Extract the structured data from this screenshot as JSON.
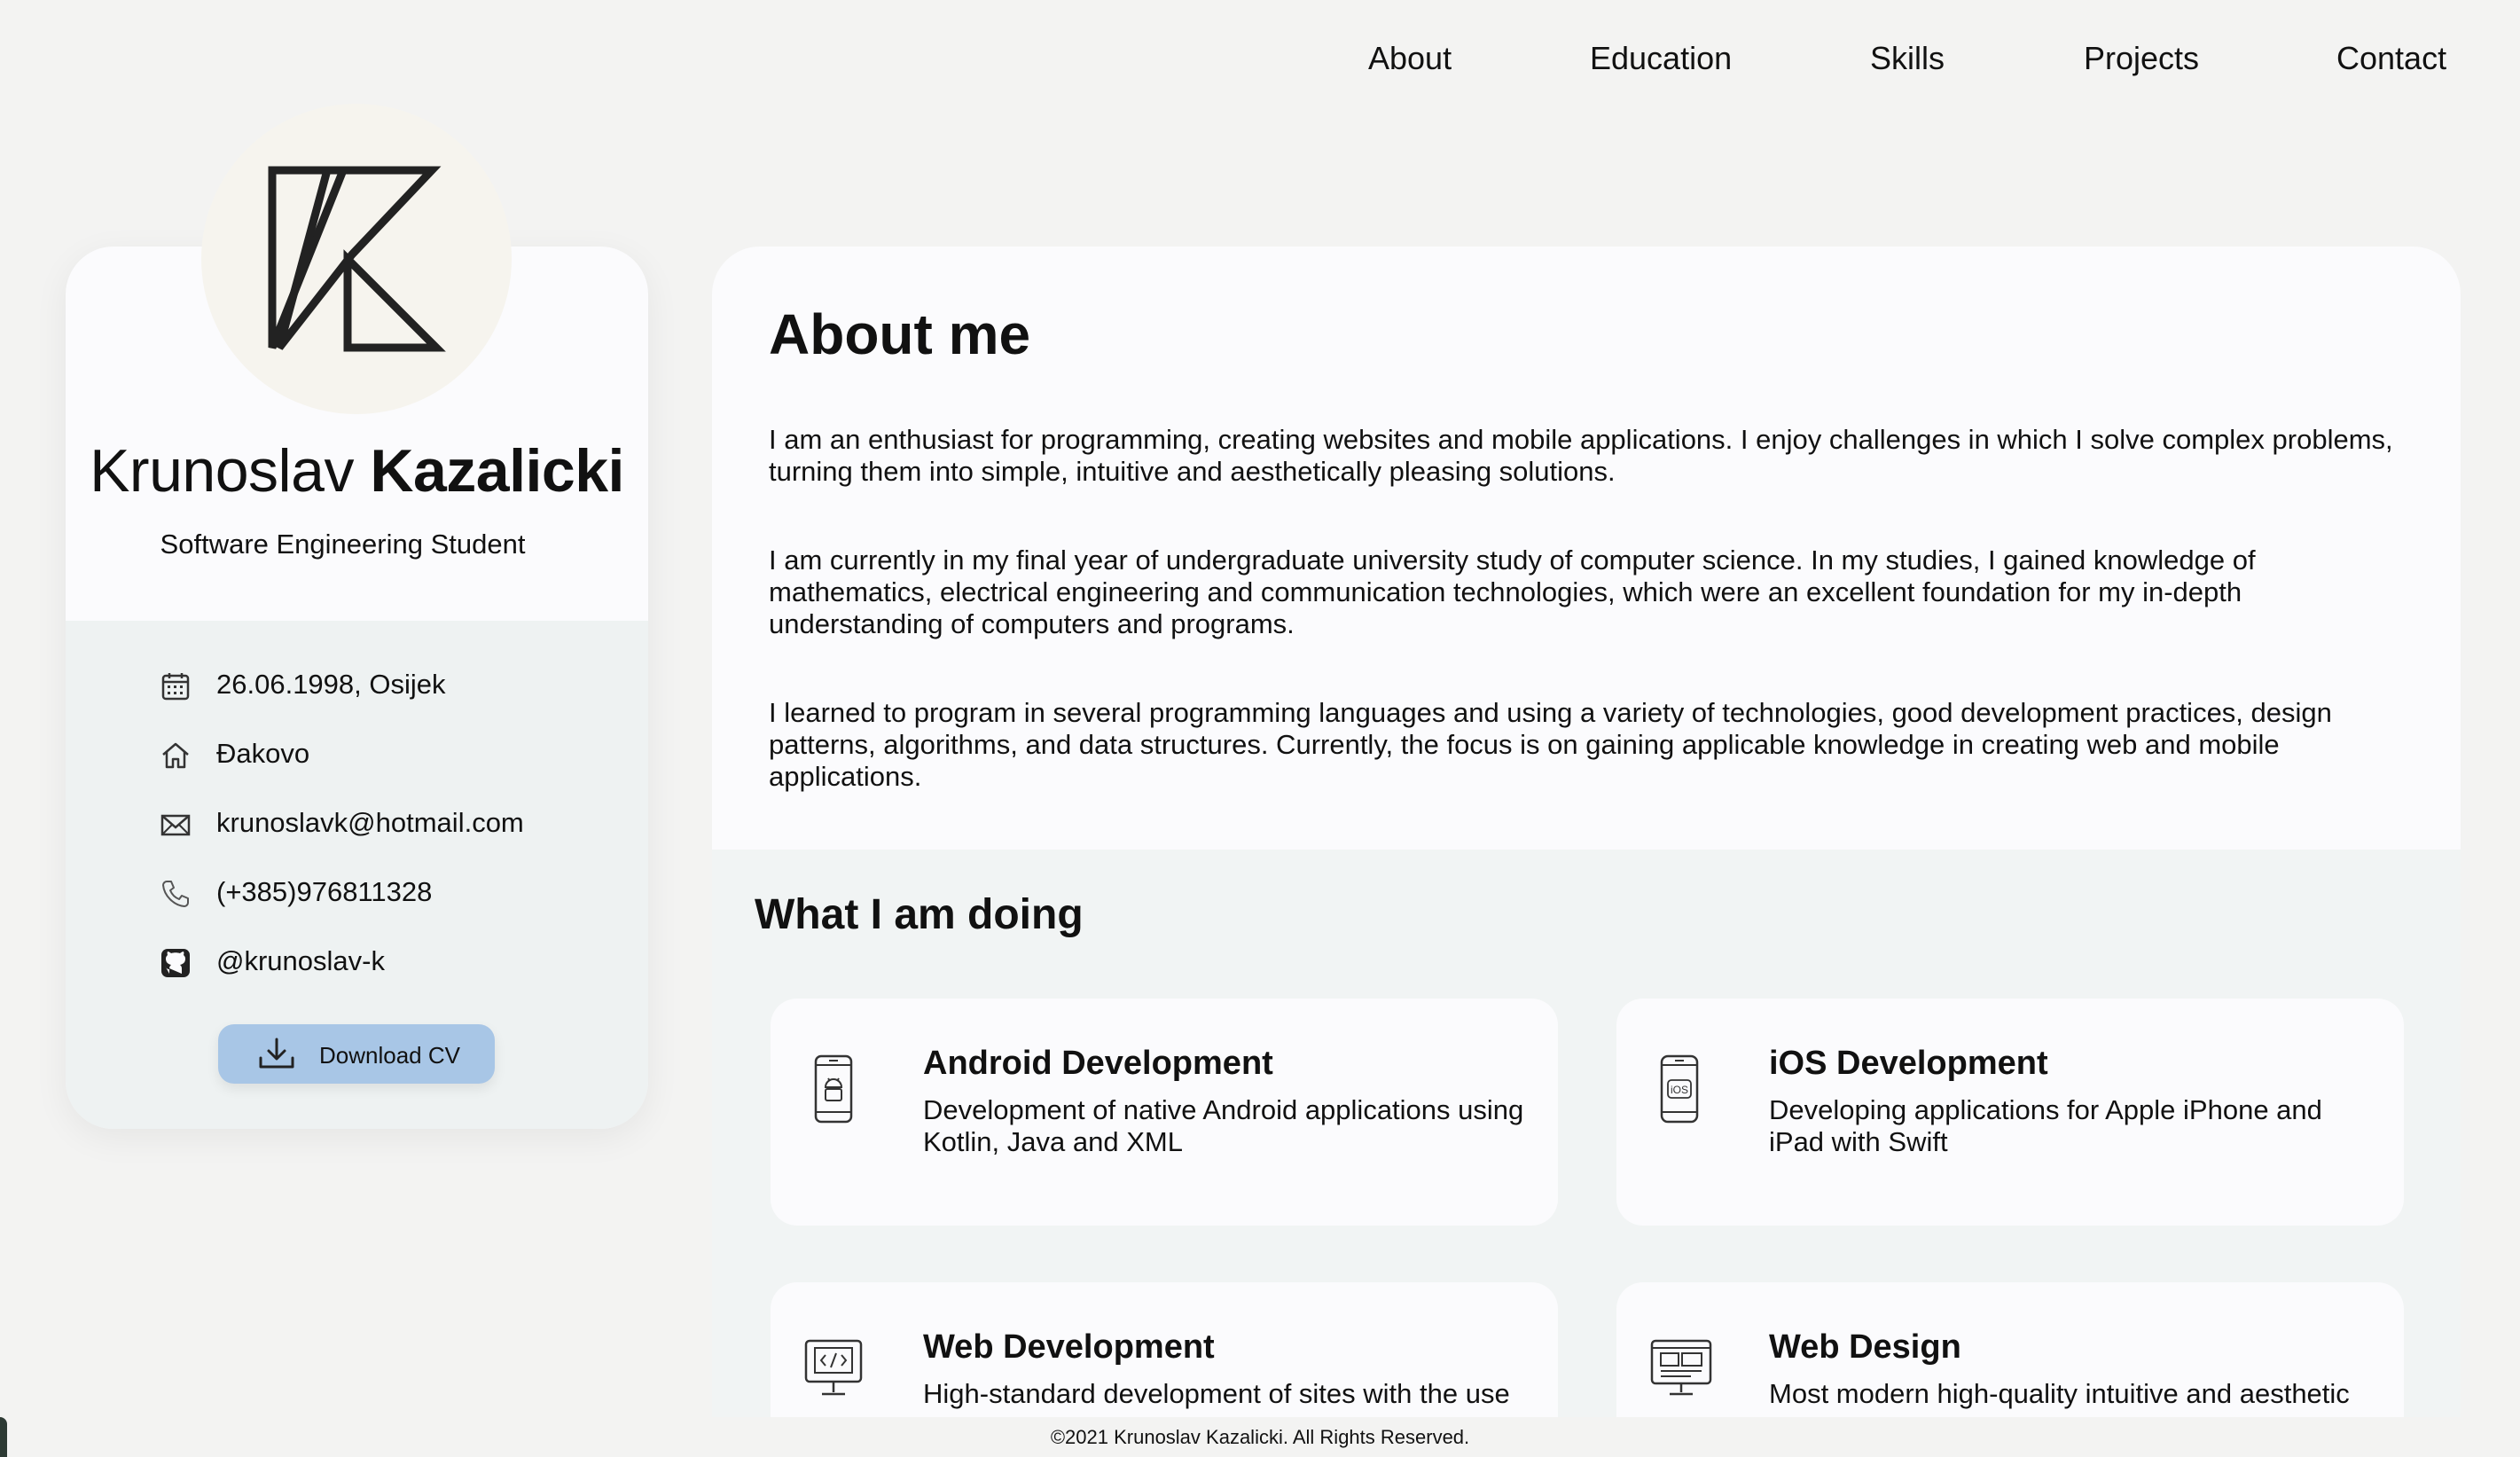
{
  "nav": {
    "items": [
      {
        "label": "About"
      },
      {
        "label": "Education"
      },
      {
        "label": "Skills"
      },
      {
        "label": "Projects"
      },
      {
        "label": "Contact"
      }
    ]
  },
  "profile": {
    "first_name": "Krunoslav",
    "last_name": "Kazalicki",
    "role": "Software Engineering Student",
    "info": [
      {
        "icon": "calendar-icon",
        "text": "26.06.1998, Osijek"
      },
      {
        "icon": "home-icon",
        "text": "Đakovo"
      },
      {
        "icon": "mail-icon",
        "text": "krunoslavk@hotmail.com"
      },
      {
        "icon": "phone-icon",
        "text": "(+385)976811328"
      },
      {
        "icon": "github-icon",
        "text": "@krunoslav-k"
      }
    ],
    "cv_button": "Download CV"
  },
  "about": {
    "title": "About me",
    "paragraphs": [
      "I am an enthusiast for programming, creating websites and mobile applications. I enjoy challenges in which I solve complex problems, turning them into simple, intuitive and aesthetically pleasing solutions.",
      "I am currently in my final year of undergraduate university study of computer science. In my studies, I gained knowledge of mathematics, electrical engineering and communication technologies, which were an excellent foundation for my in-depth understanding of computers and programs.",
      "I learned to program in several programming languages and using a variety of technologies, good development practices, design patterns, algorithms, and data structures. Currently, the focus is on gaining applicable knowledge in creating web and mobile applications."
    ]
  },
  "doing": {
    "title": "What I am doing",
    "services": [
      {
        "icon": "android-phone-icon",
        "title": "Android Development",
        "desc": "Development of native Android applications using Kotlin, Java and XML"
      },
      {
        "icon": "ios-phone-icon",
        "title": "iOS Development",
        "desc": "Developing applications for Apple iPhone and iPad with Swift"
      },
      {
        "icon": "code-monitor-icon",
        "title": "Web Development",
        "desc": "High-standard development of sites with the use"
      },
      {
        "icon": "web-design-icon",
        "title": "Web Design",
        "desc": "Most modern high-quality intuitive and aesthetic"
      }
    ]
  },
  "footer": {
    "text": "©2021 Krunoslav Kazalicki. All Rights Reserved."
  },
  "colors": {
    "background": "#f3f3f2",
    "card": "#fbfbfd",
    "card_lower": "#eef2f2",
    "button": "#a8c6e6",
    "avatar_bg": "#f6f4ee"
  }
}
